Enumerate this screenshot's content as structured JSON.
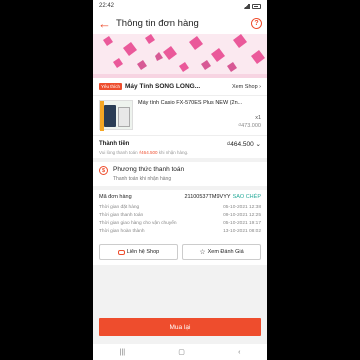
{
  "status": {
    "time": "22:42"
  },
  "header": {
    "back_icon": "arrow-left-icon",
    "title": "Thông tin đơn hàng",
    "help_icon": "question-icon"
  },
  "shop": {
    "badge": "Yêu thích",
    "name": "Máy Tính SONG LONG...",
    "view_label": "Xem Shop ›"
  },
  "product": {
    "name": "Máy tính Casio FX-570ES Plus NEW (2n...",
    "qty": "x1",
    "price": "₫473.000"
  },
  "total": {
    "label": "Thành tiền",
    "value": "₫464.500 ⌄",
    "note_prefix": "Vui lòng thanh toán ",
    "note_amount": "₫464.500",
    "note_suffix": " khi nhận hàng."
  },
  "payment": {
    "icon": "dollar-icon",
    "title": "Phương thức thanh toán",
    "method": "Thanh toán khi nhận hàng"
  },
  "order": {
    "label": "Mã đơn hàng",
    "number": "21100537TM9VYY",
    "copy_label": "SAO CHÉP",
    "rows": [
      {
        "label": "Thời gian đặt hàng",
        "value": "05-10-2021 12:38"
      },
      {
        "label": "Thời gian thanh toán",
        "value": "09-10-2021 12:25"
      },
      {
        "label": "Thời gian giao hàng cho vận chuyển",
        "value": "05-10-2021 19:17"
      },
      {
        "label": "Thời gian hoàn thành",
        "value": "13-10-2021 08:02"
      }
    ]
  },
  "actions": {
    "contact_label": "Liên hệ Shop",
    "review_label": "Xem Đánh Giá",
    "buy_again_label": "Mua lại"
  },
  "colors": {
    "accent": "#ee4d2d",
    "copy": "#26aa99"
  }
}
